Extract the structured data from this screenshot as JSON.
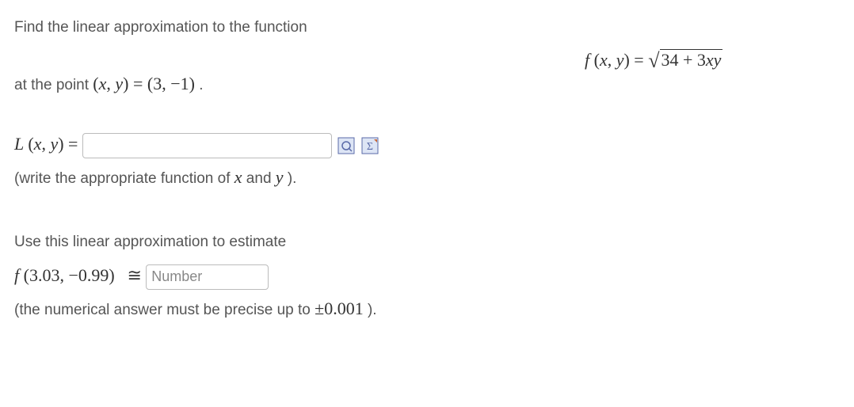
{
  "left": {
    "line1": "Find the linear approximation to the function",
    "line2_pre": "at the point ",
    "line2_math1": "(x, y) = (3, −1)",
    "line2_post": " .",
    "line3_math": "L (x, y) = ",
    "line4": "(write the appropriate function of ",
    "line4_var1": "x",
    "line4_mid": "  and ",
    "line4_var2": "y",
    "line4_end": " ).",
    "line5": "Use this linear approximation to estimate",
    "line6_math": "f (3.03, −0.99)",
    "line6_approx": "≅",
    "input2_placeholder": "Number",
    "line7_pre": "(the numerical answer must be precise up to ",
    "line7_math": "±0.001",
    "line7_post": " )."
  },
  "right": {
    "func_lhs": "f (x, y) = ",
    "sqrt_sym": "√",
    "sqrt_body": "34 + 3xy"
  }
}
